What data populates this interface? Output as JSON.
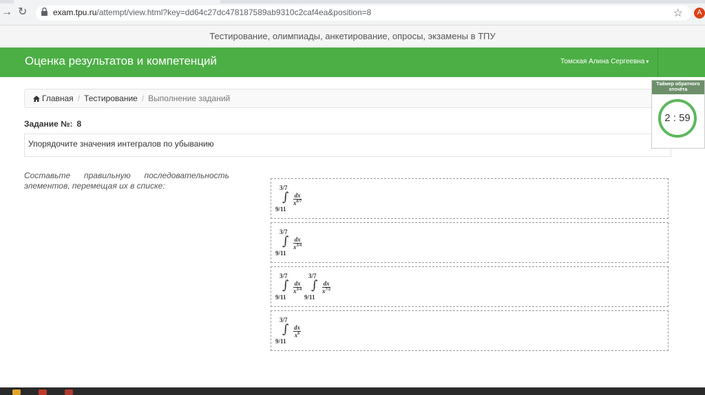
{
  "browser": {
    "url_host": "exam.tpu.ru",
    "url_path": "/attempt/view.html?key=dd64c27dc478187589ab9310c2caf4ea&position=8",
    "avatar_letter": "A"
  },
  "site": {
    "strip_text": "Тестирование, олимпиады, анкетирование, опросы, экзамены в ТПУ",
    "brand": "Оценка результатов и компетенций",
    "user": "Томская Алина Сергеевна",
    "brand_color": "#4caf45"
  },
  "breadcrumb": {
    "home": "Главная",
    "testing": "Тестирование",
    "current": "Выполнение заданий"
  },
  "task": {
    "label": "Задание №:",
    "number": "8",
    "question": "Упорядочите значения интегралов по убыванию",
    "instruction": "Составьте правильную последовательность элементов, перемещая их в списке:"
  },
  "items": [
    {
      "upper": "3/7",
      "lower": "9/11",
      "num": "dx",
      "base": "x",
      "exp": "6/7"
    },
    {
      "upper": "3/7",
      "lower": "9/11",
      "num": "dx",
      "base": "x",
      "exp": "3/4"
    },
    {
      "upper": "3/7",
      "lower": "9/11",
      "num": "dx",
      "base": "x",
      "exp": "3/4",
      "upper2": "3/7",
      "lower2": "9/11",
      "num2": "dx",
      "base2": "x",
      "exp2": "7/2"
    },
    {
      "upper": "3/7",
      "lower": "9/11",
      "num": "dx",
      "base": "x",
      "exp": "6"
    }
  ],
  "timer": {
    "title": "Таймер обратного отсчёта",
    "value": "2 : 59"
  }
}
